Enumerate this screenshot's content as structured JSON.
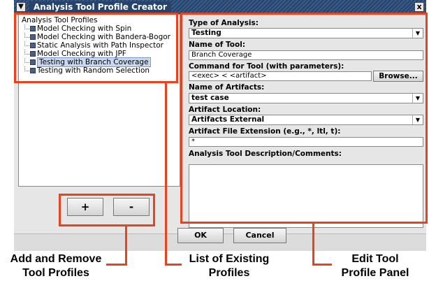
{
  "window": {
    "title": "Analysis Tool Profile Creator",
    "menu_icon": "chevron-down-icon",
    "close_glyph": "x"
  },
  "tree": {
    "root_label": "Analysis Tool Profiles",
    "items": [
      {
        "label": "Model Checking with Spin",
        "selected": false
      },
      {
        "label": "Model Checking with Bandera-Bogor",
        "selected": false
      },
      {
        "label": "Static Analysis with Path Inspector",
        "selected": false
      },
      {
        "label": "Model Checking with JPF",
        "selected": false
      },
      {
        "label": "Testing with Branch Coverage",
        "selected": true
      },
      {
        "label": "Testing with Random Selection",
        "selected": false
      }
    ]
  },
  "buttons": {
    "add": "+",
    "remove": "-",
    "ok": "OK",
    "cancel": "Cancel",
    "browse": "Browse..."
  },
  "form": {
    "type_label": "Type of Analysis:",
    "type_value": "Testing",
    "tool_name_label": "Name of Tool:",
    "tool_name_value": "Branch Coverage",
    "command_label": "Command for Tool (with parameters):",
    "command_value": "<exec> <  <artifact>",
    "artifacts_label": "Name of Artifacts:",
    "artifacts_value": "test case",
    "location_label": "Artifact Location:",
    "location_value": "Artifacts External",
    "extension_label": "Artifact File Extension (e.g., *, ltl, t):",
    "extension_value": "*",
    "description_label": "Analysis Tool Description/Comments:",
    "description_value": ""
  },
  "annotations": {
    "add_remove": "Add and Remove\nTool Profiles",
    "list": "List of Existing\nProfiles",
    "edit": "Edit Tool\nProfile Panel"
  },
  "colors": {
    "annotation_red": "#e64320",
    "titlebar": "#27436b",
    "selection": "#c9d7ee"
  }
}
